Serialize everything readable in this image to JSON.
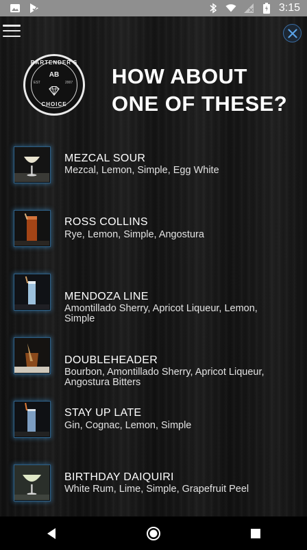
{
  "status_bar": {
    "time": "3:15",
    "left_icons": [
      "image-icon",
      "play-check-icon"
    ],
    "right_icons": [
      "bluetooth-icon",
      "wifi-icon",
      "no-sim-icon",
      "battery-icon"
    ]
  },
  "header": {
    "menu_icon": "hamburger-icon",
    "close_icon": "close-icon",
    "logo": {
      "top_text": "BARTENDER'S",
      "monogram": "AB",
      "est": "EST",
      "year": "2007",
      "bottom_text": "CHOICE"
    },
    "headline_line1": "HOW ABOUT",
    "headline_line2": "ONE OF THESE?"
  },
  "drinks": [
    {
      "name": "MEZCAL SOUR",
      "ingredients": "Mezcal, Lemon, Simple, Egg White"
    },
    {
      "name": "ROSS COLLINS",
      "ingredients": "Rye, Lemon, Simple, Angostura"
    },
    {
      "name": "MENDOZA LINE",
      "ingredients": "Amontillado Sherry, Apricot Liqueur, Lemon, Simple"
    },
    {
      "name": "DOUBLEHEADER",
      "ingredients": "Bourbon, Amontillado Sherry, Apricot Liqueur, Angostura Bitters"
    },
    {
      "name": "STAY UP LATE",
      "ingredients": "Gin, Cognac, Lemon, Simple"
    },
    {
      "name": "BIRTHDAY DAIQUIRI",
      "ingredients": "White Rum, Lime, Simple, Grapefruit Peel"
    }
  ],
  "nav_bar": {
    "back_icon": "back-triangle-icon",
    "home_icon": "home-circle-icon",
    "recents_icon": "recents-square-icon"
  },
  "colors": {
    "status_bar": "#8f8f8f",
    "background": "#151515",
    "thumb_glow": "#3c8cc8",
    "close_ring": "#3a6fa8"
  }
}
